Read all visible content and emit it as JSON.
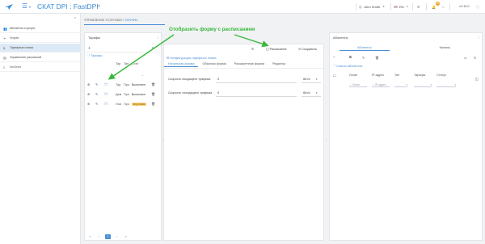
{
  "topbar": {
    "app_title": "СКАТ DPI : FastDPI",
    "user_icon": "user-icon",
    "user_name": "John Smith",
    "language": "RU",
    "notifications_count": "46",
    "version": "v.2.10.0"
  },
  "sidebar": {
    "items": [
      {
        "icon": "users-icon",
        "label": "Абоненты и услуги"
      },
      {
        "icon": "services-icon",
        "label": "Услуги"
      },
      {
        "icon": "dollar-icon",
        "label": "Тарифные планы",
        "active": true
      },
      {
        "icon": "broadcast-icon",
        "label": "Управление рассылкой"
      },
      {
        "icon": "list-icon",
        "label": "ХотСпот"
      }
    ]
  },
  "breadcrumb": {
    "section": "УПРАВЛЕНИЕ УСЛУГАМИ",
    "separator": "/",
    "current": "ТАРИФЫ"
  },
  "tariffs_panel": {
    "title": "Тарифы",
    "add_label": "+",
    "tree_root": "Тарифы",
    "columns": [
      "Тар",
      "Тип",
      "Стат"
    ],
    "rows": [
      {
        "name": "Тар",
        "type": "Про",
        "status": "Выполнен",
        "status_style": "plain"
      },
      {
        "name": "Дем",
        "type": "Про",
        "status": "Выполнен",
        "status_style": "plain"
      },
      {
        "name": "Нов",
        "type": "Про",
        "status": "Черновик",
        "status_style": "orange"
      }
    ],
    "pager": [
      "«",
      "‹",
      "1",
      "›",
      "»"
    ]
  },
  "config_panel": {
    "header": "Конфигурация тарифного плана",
    "schedule_button": "Расписание",
    "save_button": "Сохранить",
    "tabs": [
      "Начальная форма",
      "Обычная форма",
      "Расширенная форма",
      "Редактор"
    ],
    "fields": [
      {
        "label": "Скорость входящего трафика",
        "value": "0",
        "unit": "бит/с"
      },
      {
        "label": "Скорость исходящего трафика",
        "value": "0",
        "unit": "бит/с"
      }
    ]
  },
  "subscribers_panel": {
    "title": "Абоненты",
    "tabs": [
      "Абоненты",
      "Каналы"
    ],
    "list_link": "Список абонентов",
    "columns": [
      "Логин",
      "IP-адрес",
      "Тип",
      "Тарифы",
      "Статус"
    ],
    "filters": {
      "login_placeholder": "Логин",
      "ip_placeholder": "IP-адрес"
    }
  },
  "annotation": {
    "text": "Отобразить форму с расписанием",
    "color": "#37b83b"
  }
}
